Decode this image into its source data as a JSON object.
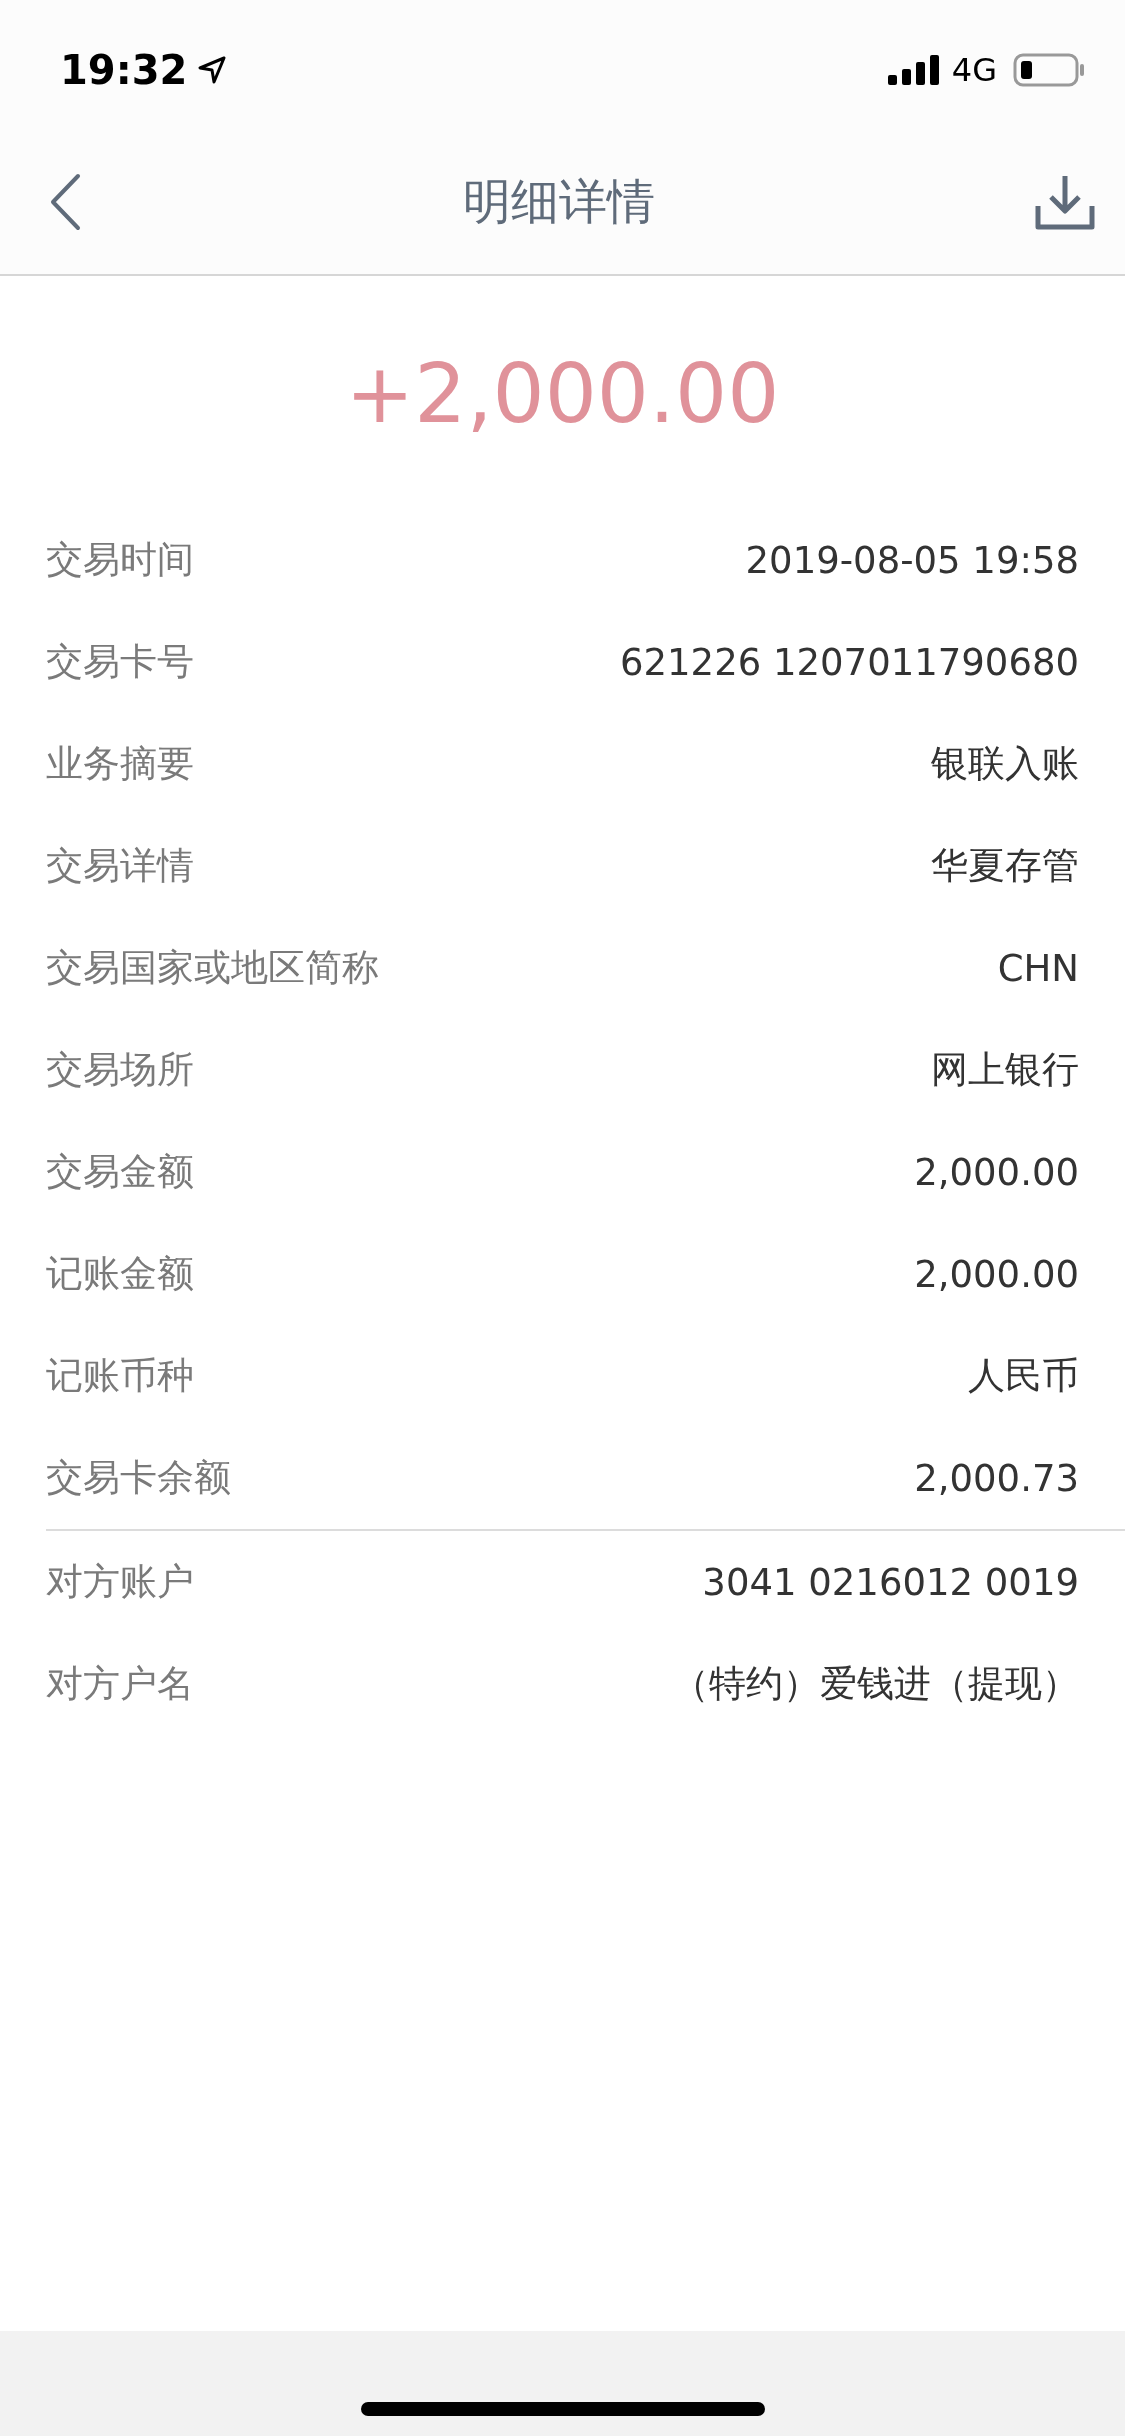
{
  "status_bar": {
    "time": "19:32",
    "network": "4G"
  },
  "nav": {
    "title": "明细详情"
  },
  "amount": "+2,000.00",
  "sections": [
    {
      "rows": [
        {
          "label": "交易时间",
          "value": "2019-08-05 19:58"
        },
        {
          "label": "交易卡号",
          "value": "621226 1207011790680"
        },
        {
          "label": "业务摘要",
          "value": "银联入账"
        },
        {
          "label": "交易详情",
          "value": "华夏存管"
        },
        {
          "label": "交易国家或地区简称",
          "value": "CHN"
        },
        {
          "label": "交易场所",
          "value": "网上银行"
        },
        {
          "label": "交易金额",
          "value": "2,000.00"
        },
        {
          "label": "记账金额",
          "value": "2,000.00"
        },
        {
          "label": "记账币种",
          "value": "人民币"
        },
        {
          "label": "交易卡余额",
          "value": "2,000.73"
        }
      ]
    },
    {
      "rows": [
        {
          "label": "对方账户",
          "value": "3041 0216012 0019"
        },
        {
          "label": "对方户名",
          "value": "（特约）爱钱进（提现）"
        }
      ]
    }
  ]
}
